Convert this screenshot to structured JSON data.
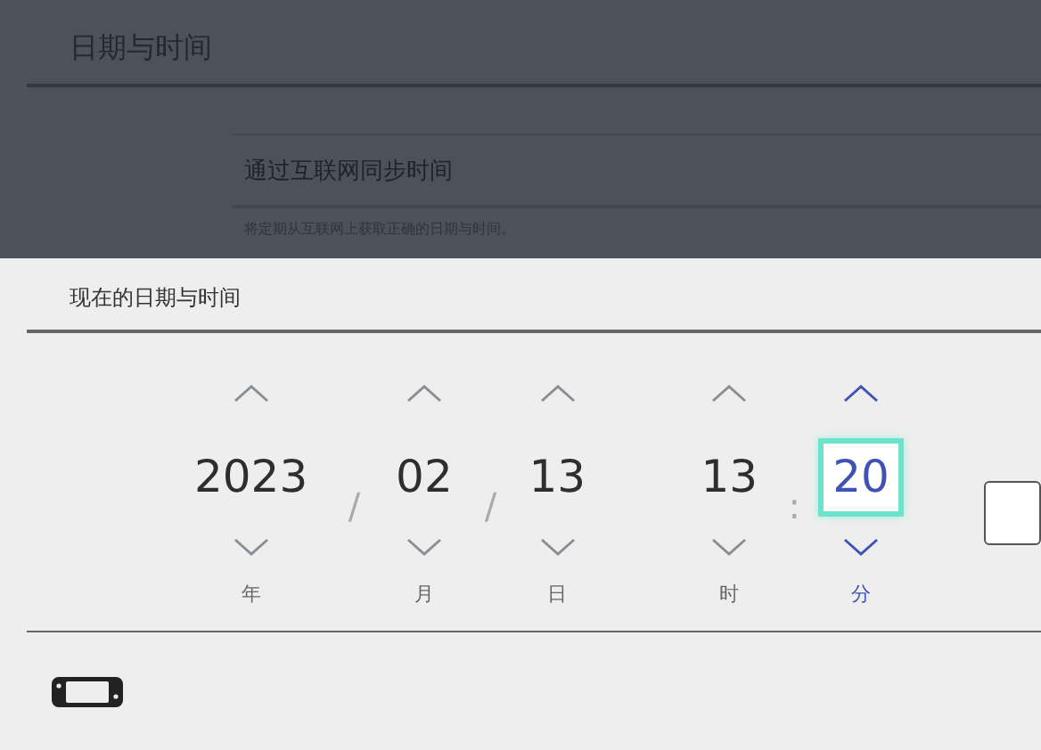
{
  "page": {
    "title": "日期与时间"
  },
  "sync_option": {
    "label": "通过互联网同步时间",
    "description": "将定期从互联网上获取正确的日期与时间。"
  },
  "dialog": {
    "title": "现在的日期与时间",
    "date_fields": [
      {
        "kind": "field",
        "value": "2023",
        "label": "年",
        "selected": false
      },
      {
        "kind": "separator",
        "text": "/"
      },
      {
        "kind": "field",
        "value": "02",
        "label": "月",
        "selected": false
      },
      {
        "kind": "separator",
        "text": "/"
      },
      {
        "kind": "field",
        "value": "13",
        "label": "日",
        "selected": false
      }
    ],
    "time_fields": [
      {
        "kind": "field",
        "value": "13",
        "label": "时",
        "selected": false
      },
      {
        "kind": "separator",
        "text": ":"
      },
      {
        "kind": "field",
        "value": "20",
        "label": "分",
        "selected": true
      }
    ]
  }
}
